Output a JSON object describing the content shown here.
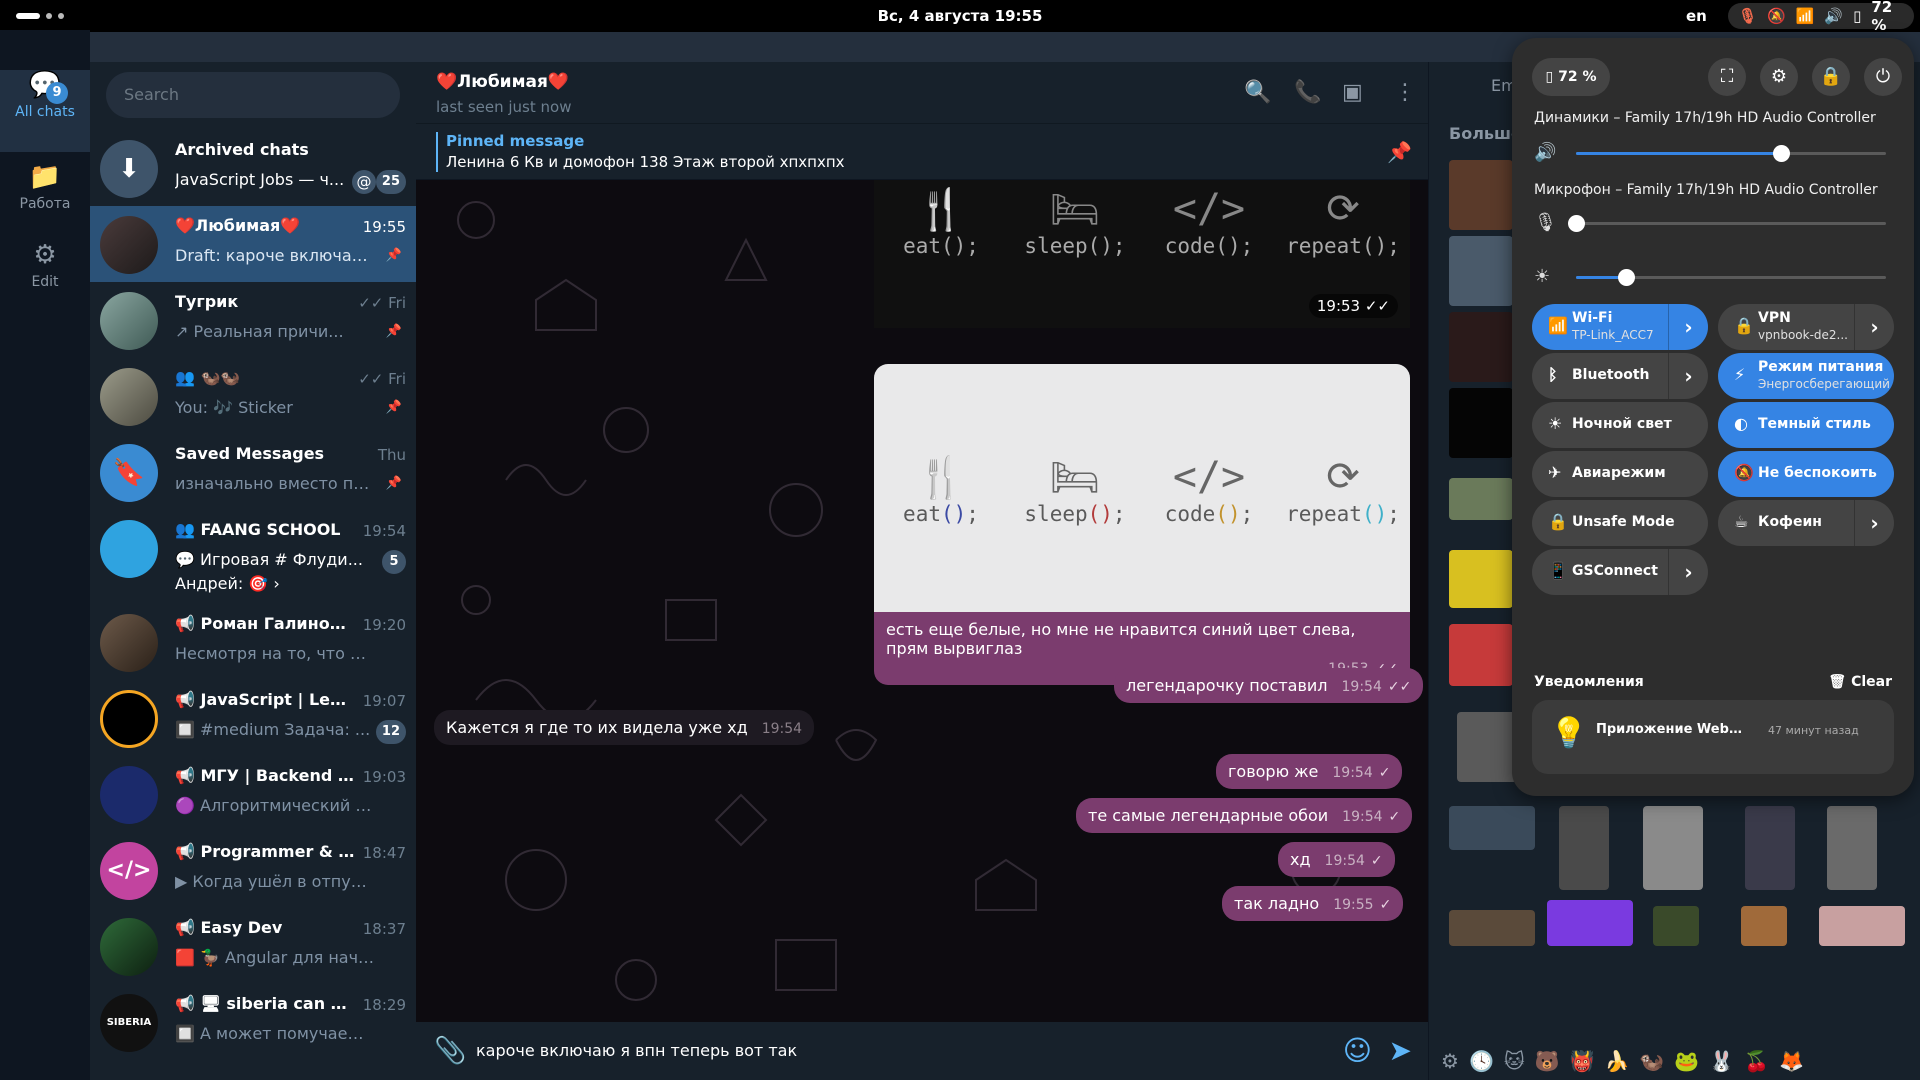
{
  "topbar": {
    "clock": "Вс, 4 августа  19:55",
    "lang": "en",
    "battery": "72 %"
  },
  "folders": [
    {
      "label": "All chats",
      "badge": "9",
      "icon": "chat-bubbles-icon"
    },
    {
      "label": "Работа",
      "icon": "folder-icon"
    },
    {
      "label": "Edit",
      "icon": "sliders-icon"
    }
  ],
  "search": {
    "placeholder": "Search"
  },
  "chats": [
    {
      "name": "Archived chats",
      "preview": "JavaScript Jobs — ч...",
      "mention": "@",
      "count": "25"
    },
    {
      "name": "❤️Любимая❤️",
      "time": "19:55",
      "preview": "Draft: кароче включаю ...",
      "active": true
    },
    {
      "name": "Тугрик",
      "time": "✓✓ Fri",
      "preview": "↗ Реальная причи..."
    },
    {
      "name": "👥 🦦🦦",
      "time": "✓✓ Fri",
      "preview": "You: 🎶 Sticker"
    },
    {
      "name": "Saved Messages",
      "time": "Thu",
      "preview": "изначально вместо па..."
    },
    {
      "name": "👥 FAANG SCHOOL",
      "time": "19:54",
      "preview": "💬 Игровая    # Флуди...",
      "preview2": "Андрей: 🎯 ›",
      "count": "5"
    },
    {
      "name": "📢 Роман Галиновск...",
      "time": "19:20",
      "preview": "Несмотря на то, что я сам п..."
    },
    {
      "name": "📢 JavaScript | LeetC...",
      "time": "19:07",
      "preview": "🔲 #medium  Задача: ...",
      "count": "12"
    },
    {
      "name": "📢 МГУ | Backend De...",
      "time": "19:03",
      "preview": "🟣 Алгоритмический трен..."
    },
    {
      "name": "📢 Programmer & IT ...",
      "time": "18:47",
      "preview": "▶ Когда ушёл в отпуск, но ..."
    },
    {
      "name": "📢 Easy Dev",
      "time": "18:37",
      "preview": "🟥 🦆 Angular для начина..."
    },
    {
      "name": "📢 🖥 siberia can code",
      "time": "18:29",
      "preview": "🔲 А может помучаем Ден..."
    }
  ],
  "chat": {
    "title": "❤️Любимая❤️",
    "status": "last seen just now",
    "pinned_label": "Pinned message",
    "pinned_text": "Ленина 6  Кв и домофон 138  Этаж второй хпхпхпх",
    "sticker_labels": [
      "eat();",
      "sleep();",
      "code();",
      "repeat();"
    ],
    "messages": [
      {
        "text": "есть еще белые, но мне не нравится синий цвет слева, прям вырвиглаз",
        "time": "19:53",
        "dir": "out"
      },
      {
        "text": "легендарочку поставил",
        "time": "19:54",
        "dir": "out"
      },
      {
        "text": "Кажется я где то их видела уже хд",
        "time": "19:54",
        "dir": "in"
      },
      {
        "text": "говорю же",
        "time": "19:54",
        "dir": "out"
      },
      {
        "text": "те самые легендарные обои",
        "time": "19:54",
        "dir": "out"
      },
      {
        "text": "хд",
        "time": "19:54",
        "dir": "out"
      },
      {
        "text": "так ладно",
        "time": "19:55",
        "dir": "out"
      }
    ],
    "image_time": "19:53",
    "composer_text": "кароче включаю я впн теперь вот так"
  },
  "side": {
    "tab": "Em",
    "more": "Больше"
  },
  "qs": {
    "battery": "72 %",
    "speaker_label": "Динамики – Family 17h/19h HD Audio Controller",
    "mic_label": "Микрофон – Family 17h/19h HD Audio Controller",
    "volume": 0.66,
    "mic_level": 0.0,
    "brightness": 0.16,
    "tiles": [
      {
        "label": "Wi-Fi",
        "sub": "TP-Link_ACC7",
        "on": true,
        "arrow": true,
        "icon": "wifi-icon"
      },
      {
        "label": "VPN",
        "sub": "vpnbook-de2...",
        "on": false,
        "arrow": true,
        "icon": "vpn-icon"
      },
      {
        "label": "Bluetooth",
        "on": false,
        "arrow": true,
        "icon": "bluetooth-icon"
      },
      {
        "label": "Режим питания",
        "sub": "Энергосберегающий",
        "on": true,
        "arrow": false,
        "icon": "power-mode-icon"
      },
      {
        "label": "Ночной свет",
        "on": false,
        "arrow": false,
        "icon": "night-light-icon"
      },
      {
        "label": "Темный стиль",
        "on": true,
        "arrow": false,
        "icon": "dark-style-icon"
      },
      {
        "label": "Авиарежим",
        "on": false,
        "arrow": false,
        "icon": "airplane-icon"
      },
      {
        "label": "Не беспокоить",
        "on": true,
        "arrow": false,
        "icon": "dnd-icon"
      },
      {
        "label": "Unsafe Mode",
        "on": false,
        "arrow": false,
        "icon": "lock-icon"
      },
      {
        "label": "Кофеин",
        "on": false,
        "arrow": true,
        "icon": "coffee-icon"
      },
      {
        "label": "GSConnect",
        "on": false,
        "arrow": true,
        "icon": "phone-link-icon"
      }
    ],
    "notif_title": "Уведомления",
    "clear": "🗑 Clear",
    "notif_app": "Приложение WebStor...",
    "notif_time": "47 минут назад"
  }
}
